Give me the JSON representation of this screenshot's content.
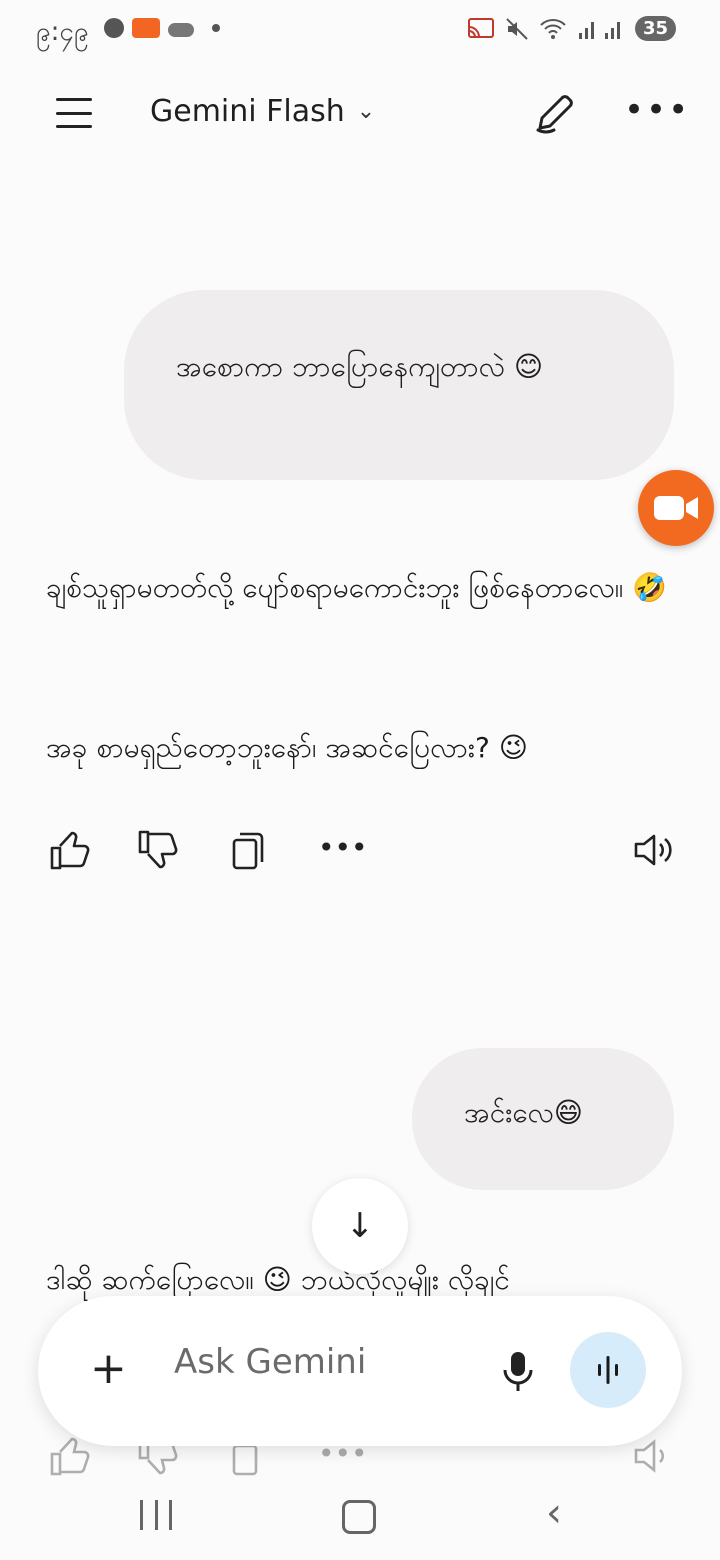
{
  "status_bar": {
    "time": "၉:၄၉",
    "battery": "35"
  },
  "header": {
    "model_name": "Gemini Flash"
  },
  "conversation": {
    "user_message_1": "အစောကာ ဘာပြောနေကျတာလဲ 😊",
    "model_message_1": "ချစ်သူရှာမတတ်လို့ ပျော်စရာမကောင်းဘူး ဖြစ်နေတာလေ။ 🤣",
    "model_message_2": "အခု စာမရှည်တော့ဘူးနော်၊ အဆင်ပြေလား? 😉",
    "user_message_2": "အင်းလေ😄",
    "model_message_3": "ဒါဆို ဆက်ပြောလေ။ 😉 ဘယ်လိုလူမျိုး လိုချင်"
  },
  "input": {
    "placeholder": "Ask Gemini"
  },
  "colors": {
    "bubble": "#efeded",
    "accent_orange": "#f16a1f",
    "live_button": "#d6ecfb"
  }
}
